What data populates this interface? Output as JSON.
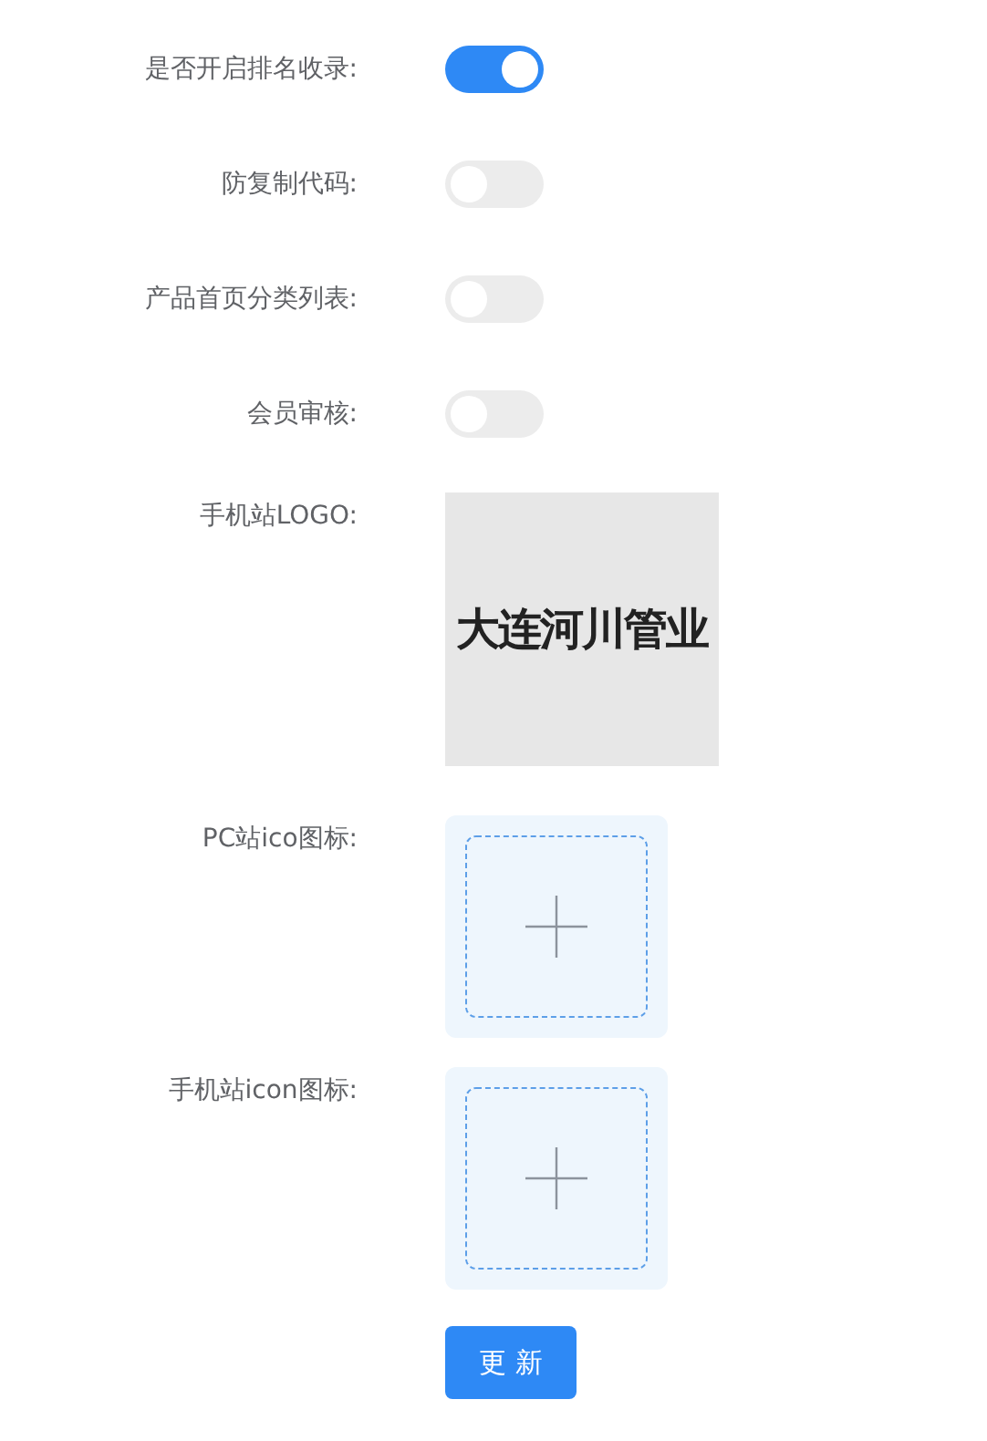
{
  "settings": [
    {
      "kind": "switch",
      "label": "是否开启排名收录:",
      "on": true
    },
    {
      "kind": "switch",
      "label": "防复制代码:",
      "on": false
    },
    {
      "kind": "switch",
      "label": "产品首页分类列表:",
      "on": false
    },
    {
      "kind": "switch",
      "label": "会员审核:",
      "on": false
    },
    {
      "kind": "logo",
      "label": "手机站LOGO:",
      "logo_text": "大连河川管业"
    },
    {
      "kind": "upload",
      "label": "PC站ico图标:"
    },
    {
      "kind": "upload",
      "label": "手机站icon图标:"
    }
  ],
  "submit": "更 新"
}
